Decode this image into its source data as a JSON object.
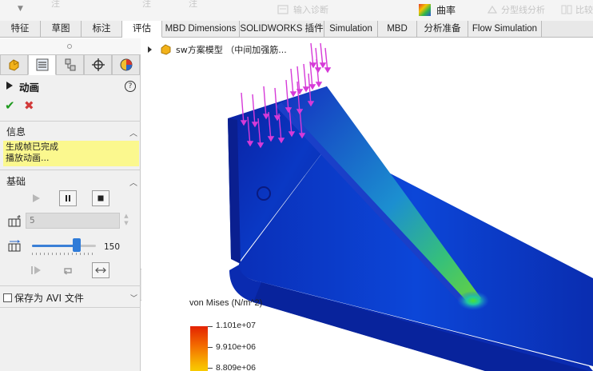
{
  "toolbar": {
    "faded_items": [
      "注",
      "注",
      "注",
      "输入诊断",
      "分型线分析",
      "比较"
    ],
    "curvature_label": "曲率"
  },
  "tabs": [
    {
      "label": "特征"
    },
    {
      "label": "草图"
    },
    {
      "label": "标注"
    },
    {
      "label": "评估"
    },
    {
      "label": "MBD Dimensions"
    },
    {
      "label": "SOLIDWORKS 插件"
    },
    {
      "label": "Simulation"
    },
    {
      "label": "MBD"
    },
    {
      "label": "分析准备"
    },
    {
      "label": "Flow Simulation"
    }
  ],
  "active_tab": "评估",
  "panel": {
    "tab_icons": [
      "feature-manager-icon",
      "property-manager-icon",
      "configuration-manager-icon",
      "dimxpert-icon",
      "display-manager-icon"
    ],
    "title": "动画",
    "info_section": {
      "title": "信息",
      "messages": [
        "生成帧已完成",
        "播放动画..."
      ]
    },
    "basic_section": {
      "title": "基础",
      "frames_value": "5",
      "speed_value": "150",
      "speed_fraction": 0.7
    },
    "save_avi_label": "保存为 AVI 文件"
  },
  "viewport": {
    "tree_item": "sw方案模型 （中间加强筋..."
  },
  "legend": {
    "title": "von Mises (N/m^2)",
    "values": [
      "1.101e+07",
      "9.910e+06",
      "8.809e+06"
    ]
  },
  "colors": {
    "accept": "#1f9a1f",
    "cancel": "#d23a3a",
    "message_bg": "#fbf88e",
    "slider": "#2f7bd8",
    "load_arrows": "#d63ad8"
  }
}
